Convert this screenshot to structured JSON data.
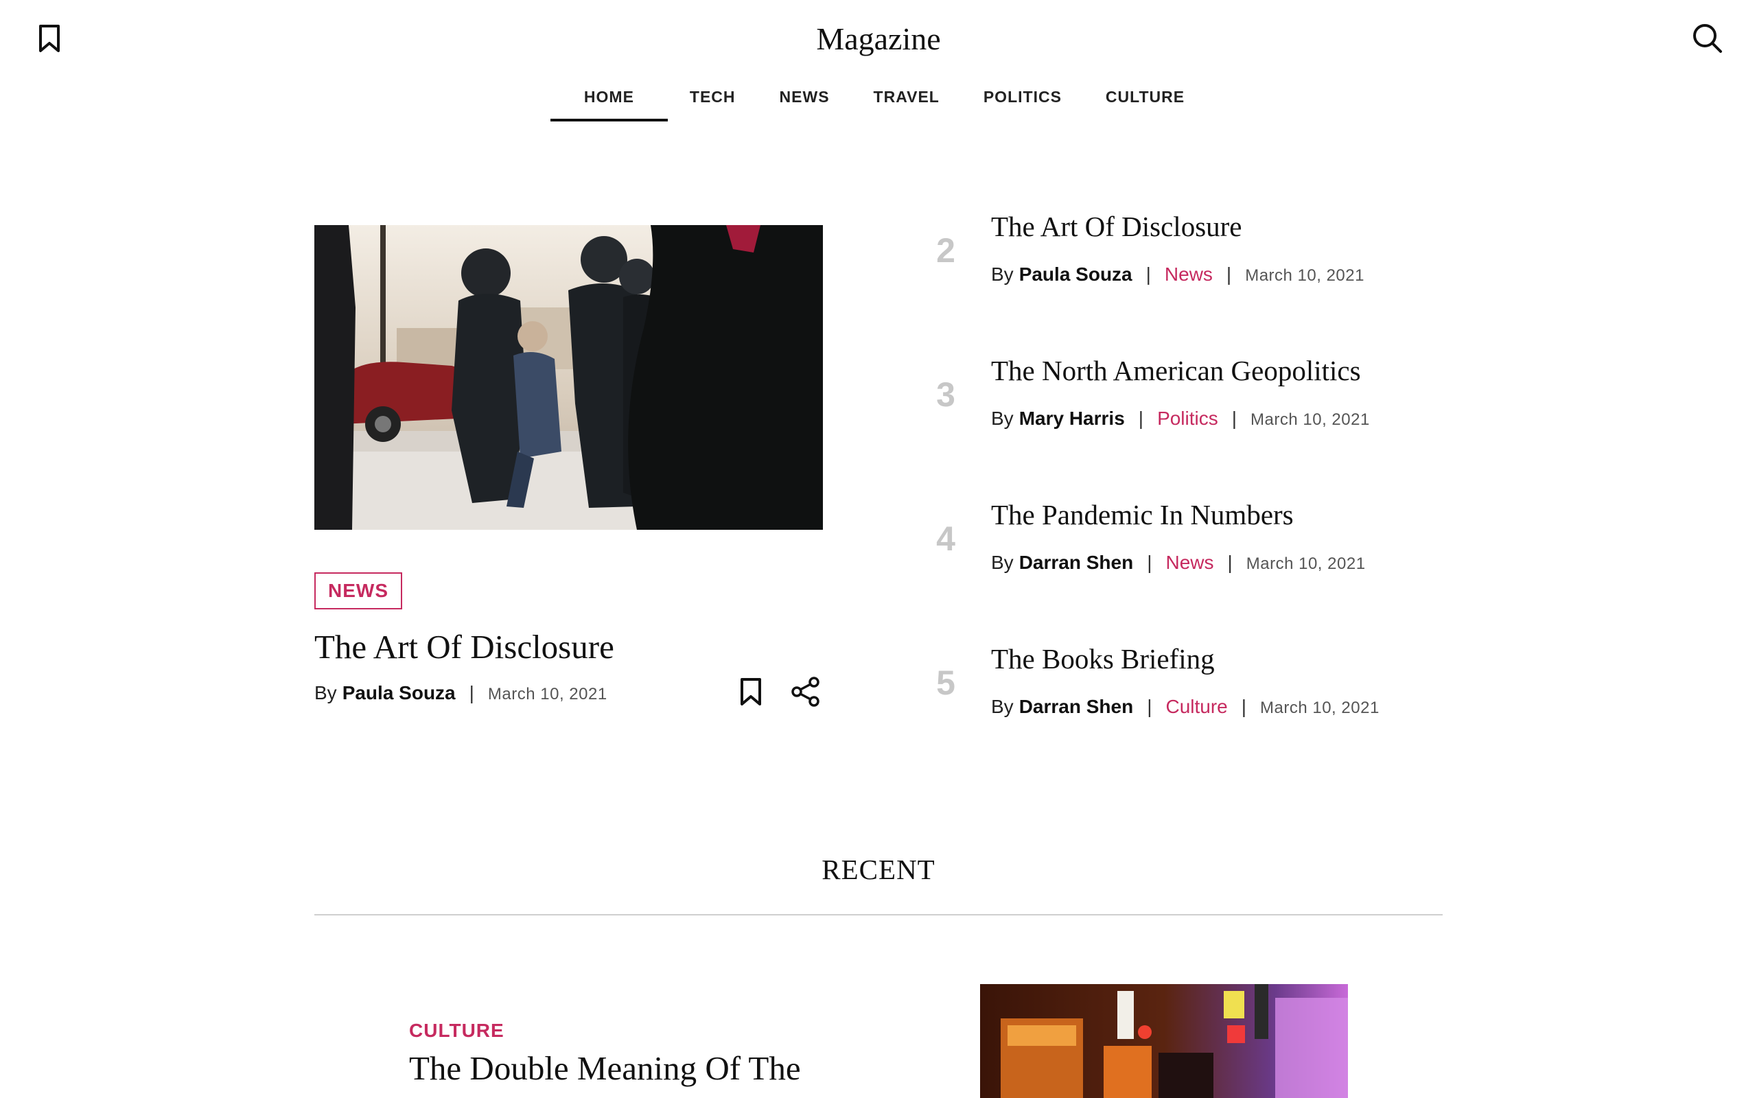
{
  "app": {
    "brand": "Magazine"
  },
  "header": {
    "left_icon": "bookmark-icon",
    "right_icon": "search-icon"
  },
  "nav": {
    "items": [
      {
        "label": "HOME",
        "active": true
      },
      {
        "label": "TECH"
      },
      {
        "label": "NEWS"
      },
      {
        "label": "TRAVEL"
      },
      {
        "label": "POLITICS"
      },
      {
        "label": "CULTURE"
      }
    ]
  },
  "featured": {
    "badge": "NEWS",
    "title": "The Art Of Disclosure",
    "by": "By",
    "author": "Paula Souza",
    "separator": "|",
    "date": "March 10, 2021",
    "actions": [
      "bookmark-icon",
      "share-icon"
    ]
  },
  "ranked": [
    {
      "rank": "2",
      "title": "The Art Of Disclosure",
      "by": "By",
      "author": "Paula Souza",
      "category": "News",
      "separator": "|",
      "date": "March 10, 2021"
    },
    {
      "rank": "3",
      "title": "The North American Geopolitics",
      "by": "By",
      "author": "Mary Harris",
      "category": "Politics",
      "separator": "|",
      "date": "March 10, 2021"
    },
    {
      "rank": "4",
      "title": "The Pandemic In Numbers",
      "by": "By",
      "author": "Darran Shen",
      "category": "News",
      "separator": "|",
      "date": "March 10, 2021"
    },
    {
      "rank": "5",
      "title": "The Books Briefing",
      "by": "By",
      "author": "Darran Shen",
      "category": "Culture",
      "separator": "|",
      "date": "March 10, 2021"
    }
  ],
  "recent": {
    "heading": "RECENT",
    "first": {
      "category": "CULTURE",
      "title": "The Double Meaning Of The"
    }
  },
  "colors": {
    "accent": "#c62a5f",
    "text": "#111111",
    "muted_rank": "#c7c7c7",
    "divider": "#cfcfcf"
  }
}
